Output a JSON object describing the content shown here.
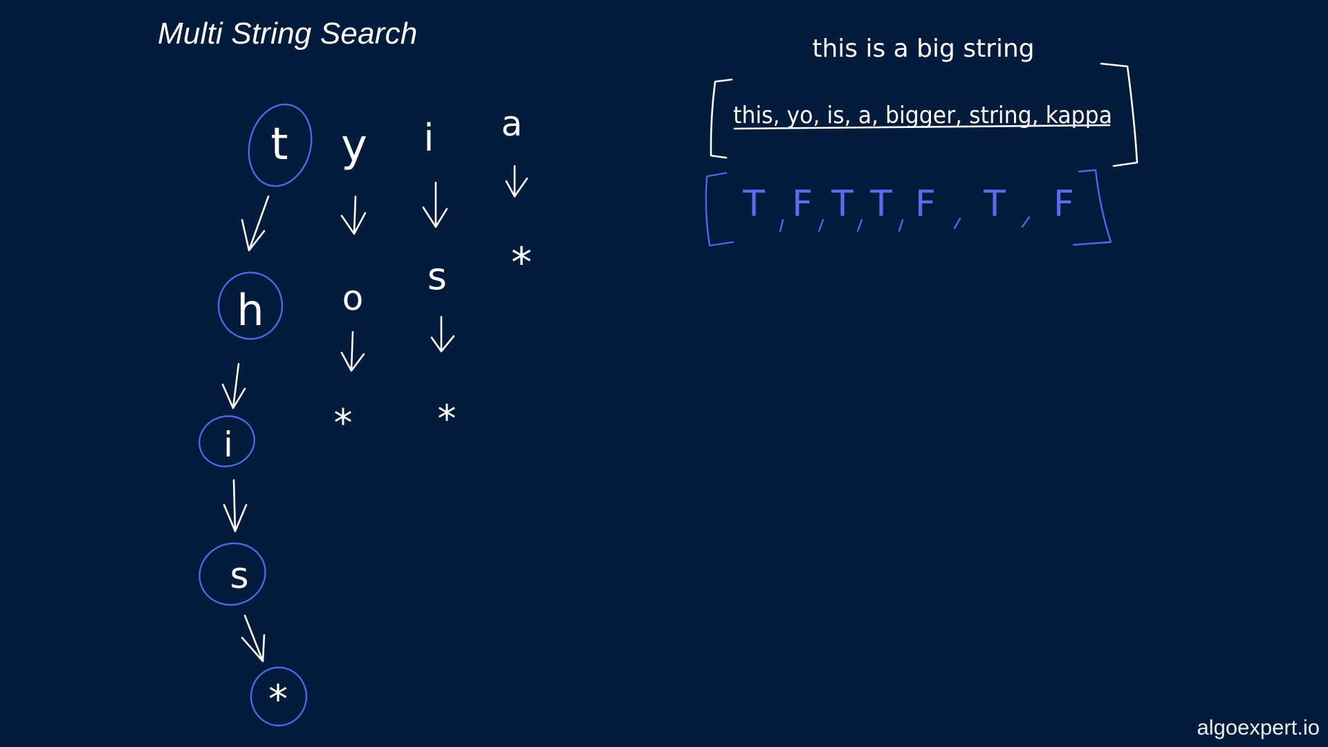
{
  "title": "Multi String Search",
  "big_string": "this is a big string",
  "small_strings": {
    "text": "this, yo, is, a, bigger, string, kappa",
    "items": [
      "this",
      "yo",
      "is",
      "a",
      "bigger",
      "string",
      "kappa"
    ]
  },
  "results": [
    "T",
    "F",
    "T",
    "T",
    "F",
    "T",
    "F"
  ],
  "trie": {
    "root_branch": [
      "t",
      "h",
      "i",
      "s",
      "*"
    ],
    "branch_y": [
      "y",
      "o",
      "*"
    ],
    "branch_i": [
      "i",
      "s",
      "*"
    ],
    "branch_a": [
      "a",
      "*"
    ]
  },
  "colors": {
    "background": "#031c3b",
    "ink": "#ffffff",
    "highlight": "#5464ec"
  },
  "watermark": "algoexpert.io"
}
